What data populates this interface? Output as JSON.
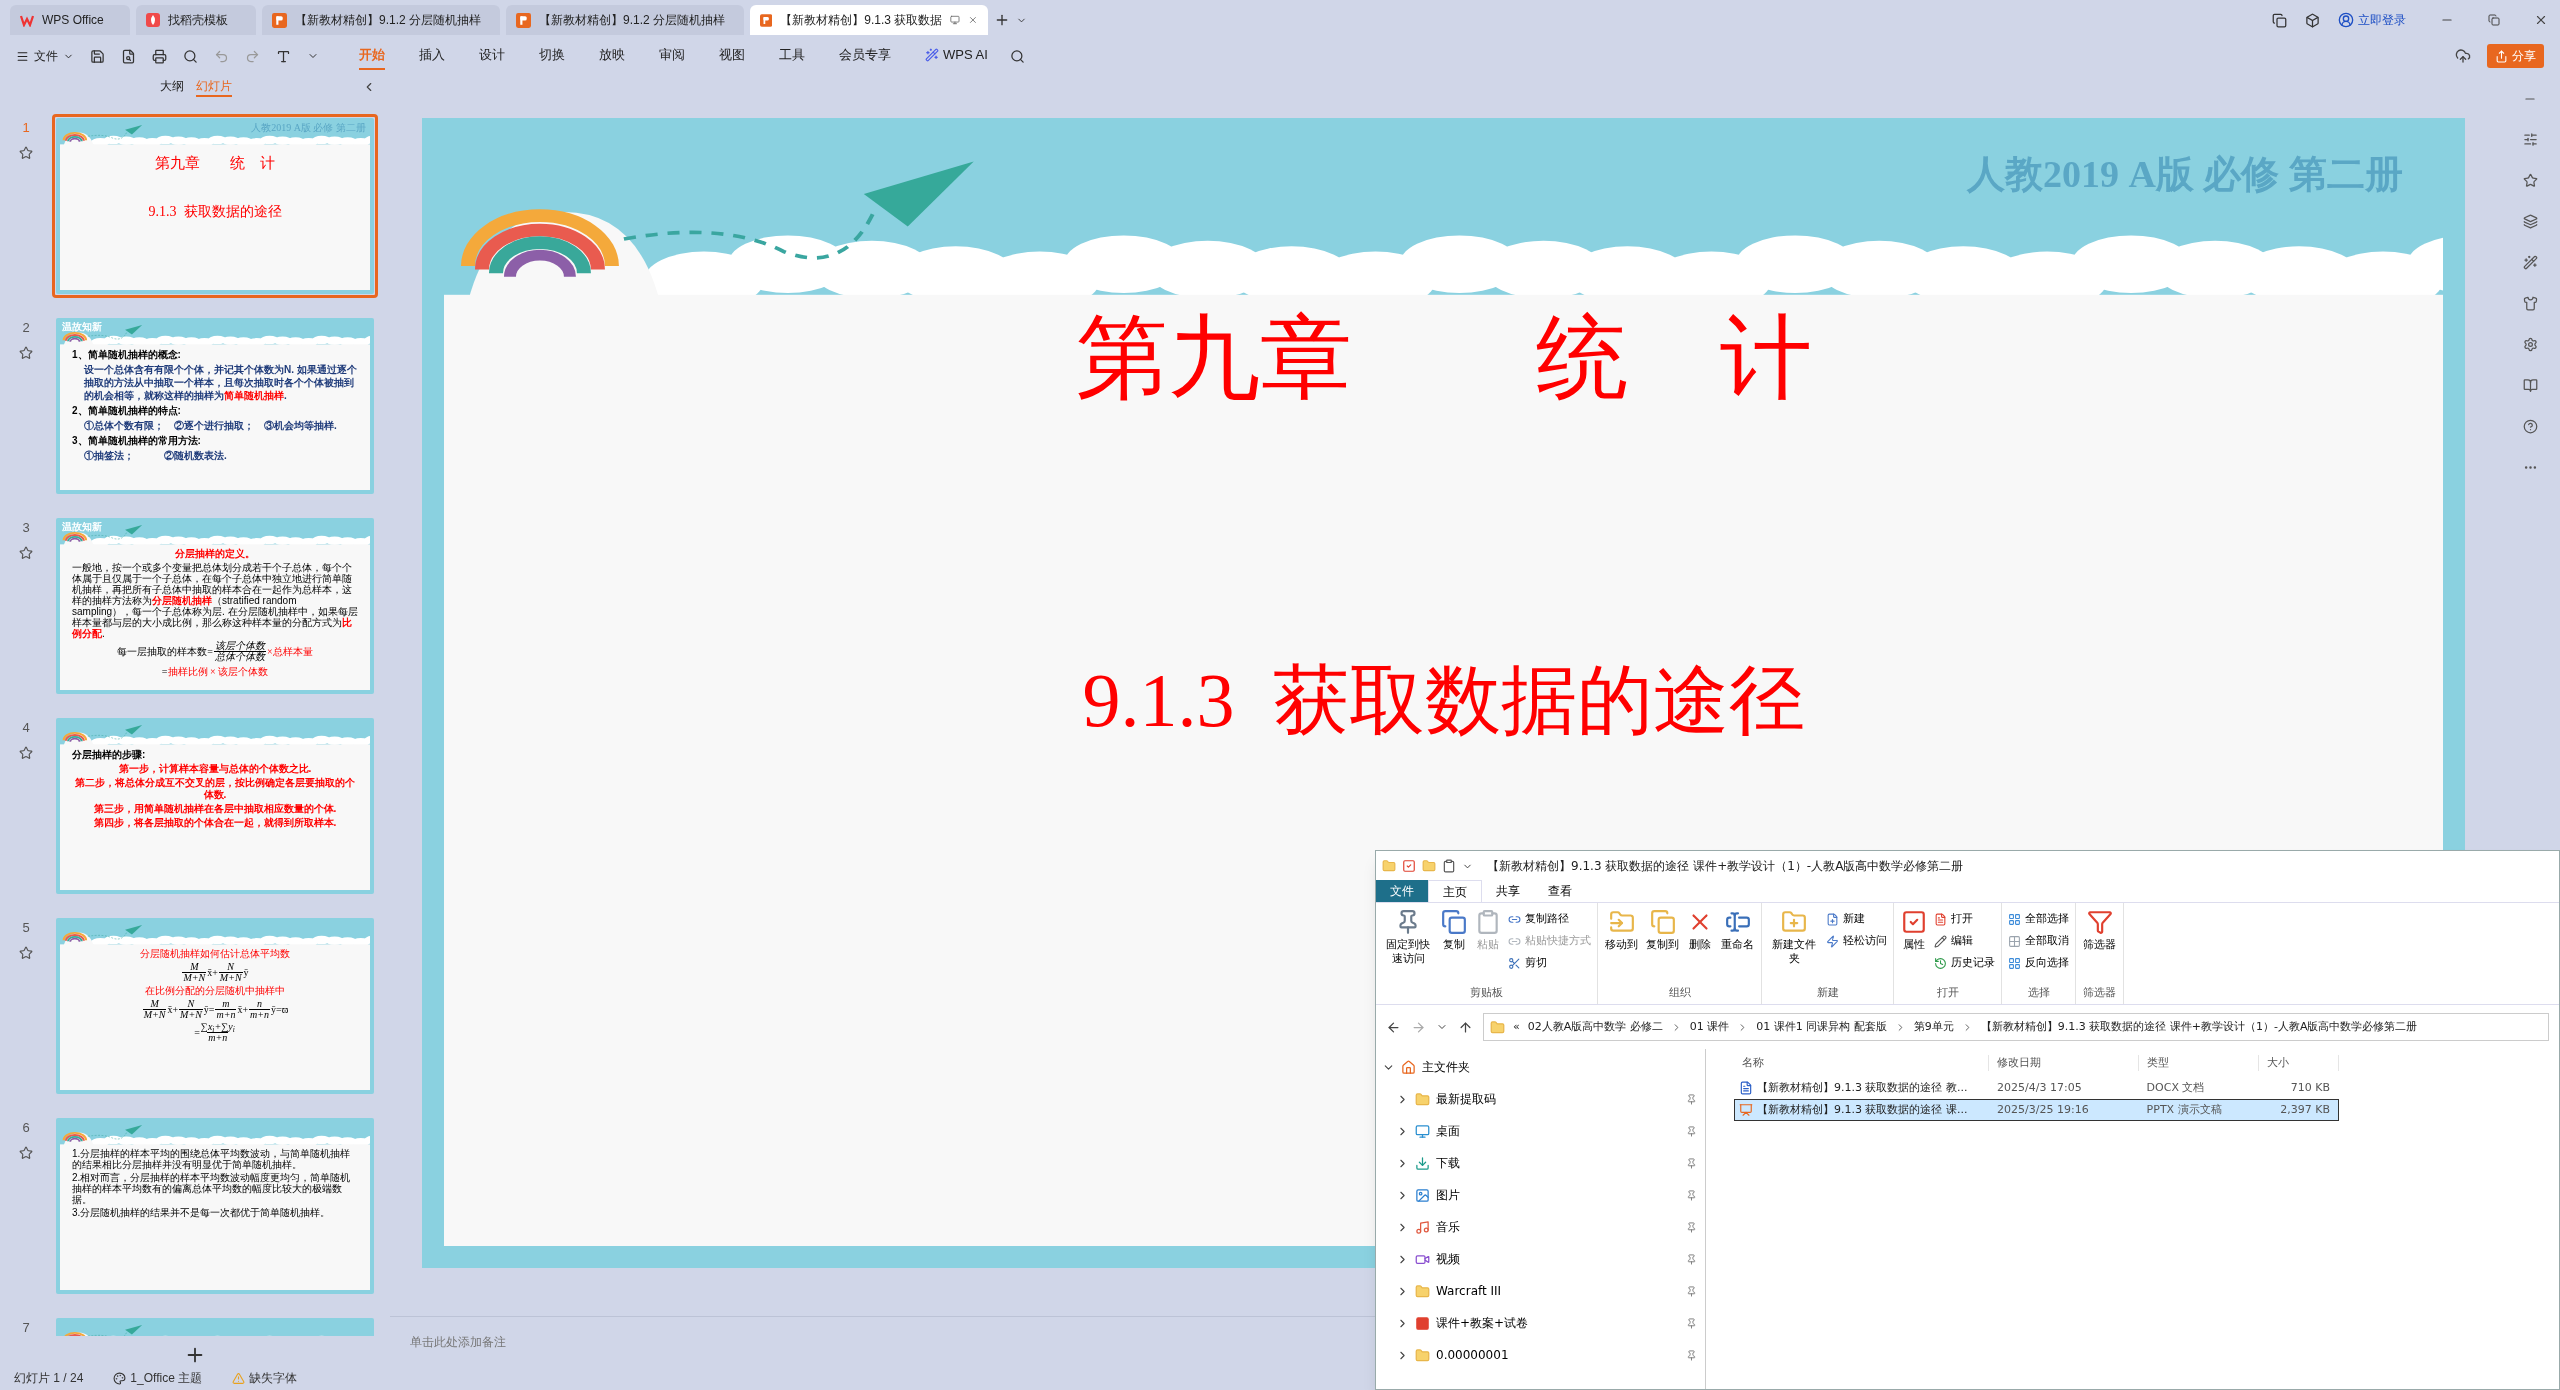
{
  "tabs": [
    {
      "label": "WPS Office",
      "kind": "wps",
      "selected": false
    },
    {
      "label": "找稻壳模板",
      "kind": "docer",
      "selected": false
    },
    {
      "label": "【新教材精创】9.1.2 分层随机抽样",
      "kind": "ppt",
      "selected": false
    },
    {
      "label": "【新教材精创】9.1.2 分层随机抽样",
      "kind": "ppt",
      "selected": false
    },
    {
      "label": "【新教材精创】9.1.3 获取数据",
      "kind": "ppt",
      "selected": true
    }
  ],
  "account": {
    "login": "立即登录",
    "share": "分享"
  },
  "toolbar": {
    "file": "文件",
    "ribbon_tabs": [
      {
        "label": "开始",
        "selected": true
      },
      {
        "label": "插入",
        "selected": false
      },
      {
        "label": "设计",
        "selected": false
      },
      {
        "label": "切换",
        "selected": false
      },
      {
        "label": "放映",
        "selected": false
      },
      {
        "label": "审阅",
        "selected": false
      },
      {
        "label": "视图",
        "selected": false
      },
      {
        "label": "工具",
        "selected": false
      },
      {
        "label": "会员专享",
        "selected": false
      },
      {
        "label": "WPS AI",
        "selected": false
      }
    ]
  },
  "panel_tabs": [
    {
      "label": "大纲",
      "selected": false
    },
    {
      "label": "幻灯片",
      "selected": true
    }
  ],
  "slides": [
    {
      "number": "1",
      "selected": true,
      "kind": "title",
      "header": "人教2019 A版 必修 第二册",
      "title": "第九章　　统　计",
      "subtitle": "9.1.3  获取数据的途径"
    },
    {
      "number": "2",
      "selected": false,
      "kind": "content",
      "badge": "温故知新",
      "blocks": [
        {
          "kind": "heading",
          "text": "1、简单随机抽样的概念:"
        },
        {
          "kind": "body",
          "text": "设一个总体含有有限个个体，并记其个体数为N. 如果通过逐个抽取的方法从中抽取一个样本，且每次抽取时各个个体被抽到的机会相等，就称这样的抽样为**简单随机抽样**."
        },
        {
          "kind": "heading",
          "text": "2、简单随机抽样的特点:"
        },
        {
          "kind": "body",
          "text": "①总体个数有限；　②逐个进行抽取；　③机会均等抽样."
        },
        {
          "kind": "heading",
          "text": "3、简单随机抽样的常用方法:"
        },
        {
          "kind": "body",
          "text": "①抽签法；　　　②随机数表法."
        }
      ]
    },
    {
      "number": "3",
      "selected": false,
      "kind": "content",
      "badge": "温故知新",
      "blocks": [
        {
          "kind": "red",
          "text": "分层抽样的定义。"
        },
        {
          "kind": "plain",
          "text": "一般地，按一个或多个变量把总体划分成若干个子总体，每个个体属于且仅属于一个子总体，在每个子总体中独立地进行简单随机抽样，再把所有子总体中抽取的样本合在一起作为总样本，这样的抽样方法称为**分层随机抽样**（stratified random sampling），每一个子总体称为层. 在分层随机抽样中，如果每层样本量都与层的大小成比例，那么称这种样本量的分配方式为**比例分配**."
        },
        {
          "kind": "formula",
          "parts": [
            {
              "kind": "text",
              "text": "每一层抽取的样本数="
            },
            {
              "kind": "frac",
              "num": "该层个体数",
              "den": "总体个体数"
            },
            {
              "kind": "red",
              "text": "×总样本量"
            }
          ]
        },
        {
          "kind": "formula",
          "parts": [
            {
              "kind": "text",
              "text": "="
            },
            {
              "kind": "red",
              "text": "抽样比例 × 该层个体数"
            }
          ]
        }
      ]
    },
    {
      "number": "4",
      "selected": false,
      "kind": "content",
      "blocks": [
        {
          "kind": "heading",
          "text": "分层抽样的步骤:"
        },
        {
          "kind": "red",
          "text": "第一步，计算样本容量与总体的个体数之比."
        },
        {
          "kind": "red",
          "text": "第二步，将总体分成互不交叉的层，按比例确定各层要抽取的个体数."
        },
        {
          "kind": "red",
          "text": "第三步，用简单随机抽样在各层中抽取相应数量的个体."
        },
        {
          "kind": "red",
          "text": "第四步，将各层抽取的个体合在一起，就得到所取样本."
        }
      ]
    },
    {
      "number": "5",
      "selected": false,
      "kind": "content",
      "blocks": [
        {
          "kind": "caption",
          "text": "分层随机抽样如何估计总体平均数"
        },
        {
          "kind": "formula",
          "parts": [
            {
              "kind": "frac",
              "num": "M",
              "den": "M+N"
            },
            {
              "kind": "text",
              "text": "x̄+"
            },
            {
              "kind": "frac",
              "num": "N",
              "den": "M+N"
            },
            {
              "kind": "text",
              "text": "ȳ"
            }
          ]
        },
        {
          "kind": "caption",
          "text": "在比例分配的分层随机中抽样中"
        },
        {
          "kind": "formula",
          "parts": [
            {
              "kind": "frac",
              "num": "M",
              "den": "M+N"
            },
            {
              "kind": "text",
              "text": "x̄+"
            },
            {
              "kind": "frac",
              "num": "N",
              "den": "M+N"
            },
            {
              "kind": "text",
              "text": "ȳ="
            },
            {
              "kind": "frac",
              "num": "m",
              "den": "m+n"
            },
            {
              "kind": "text",
              "text": "x̄+"
            },
            {
              "kind": "frac",
              "num": "n",
              "den": "m+n"
            },
            {
              "kind": "text",
              "text": "ȳ=ϖ"
            }
          ]
        },
        {
          "kind": "formula",
          "parts": [
            {
              "kind": "text",
              "text": "="
            },
            {
              "kind": "frac",
              "num": "∑x$_{i}$+∑y$_{i}$",
              "den": "m+n"
            }
          ]
        }
      ]
    },
    {
      "number": "6",
      "selected": false,
      "kind": "content",
      "blocks": [
        {
          "kind": "plain",
          "text": "1.分层抽样的样本平均的围绕总体平均数波动，与简单随机抽样的结果相比分层抽样并没有明显优于简单随机抽样。"
        },
        {
          "kind": "plain",
          "text": "2.相对而言，分层抽样的样本平均数波动幅度更均匀，简单随机抽样的样本平均数有的偏离总体平均数的幅度比较大的极端数据。"
        },
        {
          "kind": "plain",
          "text": "3.分层随机抽样的结果并不是每一次都优于简单随机抽样。"
        }
      ]
    },
    {
      "number": "7",
      "selected": false,
      "kind": "partial"
    }
  ],
  "main_slide": {
    "header": "人教2019 A版 必修 第二册",
    "title": "第九章　　统　计",
    "subtitle": "9.1.3  获取数据的途径"
  },
  "notes_placeholder": "单击此处添加备注",
  "status_bar": [
    {
      "kind": "count",
      "text": "幻灯片 1 / 24"
    },
    {
      "kind": "theme",
      "text": "1_Office 主题"
    },
    {
      "kind": "warning",
      "text": "缺失字体"
    }
  ],
  "explorer": {
    "title": "【新教材精创】9.1.3 获取数据的途径 课件+教学设计（1）-人教A版高中数学必修第二册",
    "ribbon_tabs": [
      {
        "label": "文件",
        "kind": "file",
        "selected": false
      },
      {
        "label": "主页",
        "kind": "tab",
        "selected": true
      },
      {
        "label": "共享",
        "kind": "tab",
        "selected": false
      },
      {
        "label": "查看",
        "kind": "tab",
        "selected": false
      }
    ],
    "groups": [
      {
        "label": "剪贴板",
        "large": [
          {
            "label": "固定到快速访问",
            "disabled": false
          },
          {
            "label": "复制",
            "disabled": false
          },
          {
            "label": "粘贴",
            "disabled": true
          }
        ],
        "small": [
          {
            "label": "复制路径",
            "disabled": false
          },
          {
            "label": "粘贴快捷方式",
            "disabled": true
          },
          {
            "label": "剪切",
            "disabled": false
          }
        ]
      },
      {
        "label": "组织",
        "large": [
          {
            "label": "移动到",
            "disabled": false
          },
          {
            "label": "复制到",
            "disabled": false
          },
          {
            "label": "删除",
            "disabled": false
          },
          {
            "label": "重命名",
            "disabled": false
          }
        ]
      },
      {
        "label": "新建",
        "large": [
          {
            "label": "新建文件夹",
            "disabled": false
          }
        ],
        "small": [
          {
            "label": "新建",
            "disabled": false
          },
          {
            "label": "轻松访问",
            "disabled": false
          }
        ]
      },
      {
        "label": "打开",
        "large": [
          {
            "label": "属性",
            "disabled": false
          }
        ],
        "small": [
          {
            "label": "打开",
            "disabled": false
          },
          {
            "label": "编辑",
            "disabled": false
          },
          {
            "label": "历史记录",
            "disabled": false
          }
        ]
      },
      {
        "label": "选择",
        "small": [
          {
            "label": "全部选择",
            "disabled": false
          },
          {
            "label": "全部取消",
            "disabled": false
          },
          {
            "label": "反向选择",
            "disabled": false
          }
        ]
      },
      {
        "label": "筛选器",
        "large": [
          {
            "label": "筛选器",
            "disabled": false
          }
        ]
      }
    ],
    "breadcrumbs": [
      "«",
      "02人教A版高中数学 必修二",
      "01 课件",
      "01 课件1 同课异构 配套版",
      "第9单元",
      "【新教材精创】9.1.3 获取数据的途径 课件+教学设计（1）-人教A版高中数学必修第二册"
    ],
    "tree": [
      {
        "label": "主文件夹",
        "expanded": true,
        "children": [
          {
            "label": "最新提取码",
            "expanded": false
          },
          {
            "label": "桌面",
            "expanded": false
          },
          {
            "label": "下载",
            "expanded": false
          },
          {
            "label": "图片",
            "expanded": false
          },
          {
            "label": "音乐",
            "expanded": false
          },
          {
            "label": "视频",
            "expanded": false
          },
          {
            "label": "Warcraft III",
            "expanded": false
          },
          {
            "label": "课件+教案+试卷",
            "expanded": false
          },
          {
            "label": "0.00000001",
            "expanded": false
          }
        ]
      }
    ],
    "columns": [
      "名称",
      "修改日期",
      "类型",
      "大小"
    ],
    "files": [
      {
        "kind": "docx",
        "name": "【新教材精创】9.1.3 获取数据的途径 教...",
        "date": "2025/4/3 17:05",
        "type": "DOCX 文档",
        "size": "710 KB",
        "selected": false
      },
      {
        "kind": "pptx",
        "name": "【新教材精创】9.1.3 获取数据的途径 课...",
        "date": "2025/3/25 19:16",
        "type": "PPTX 演示文稿",
        "size": "2,397 KB",
        "selected": true
      }
    ]
  }
}
